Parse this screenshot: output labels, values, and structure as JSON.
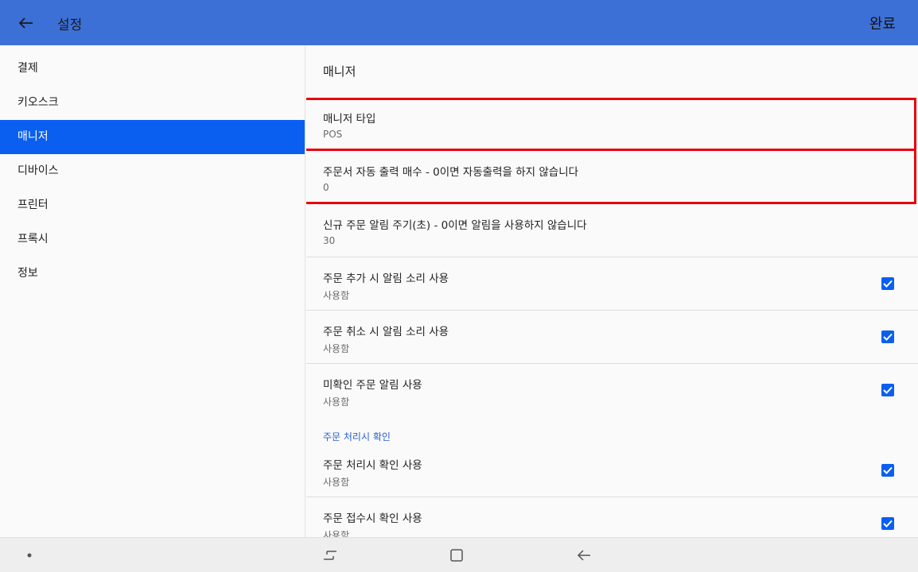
{
  "appbar": {
    "title": "설정",
    "done_label": "완료",
    "color": "#3d70d6"
  },
  "sidebar": {
    "items": [
      {
        "label": "결제",
        "active": false
      },
      {
        "label": "키오스크",
        "active": false
      },
      {
        "label": "매니저",
        "active": true
      },
      {
        "label": "디바이스",
        "active": false
      },
      {
        "label": "프린터",
        "active": false
      },
      {
        "label": "프록시",
        "active": false
      },
      {
        "label": "정보",
        "active": false
      }
    ],
    "active_color": "#0a5ff0"
  },
  "main": {
    "header": "매니저",
    "settings": [
      {
        "title": "매니저 타입",
        "value": "POS",
        "highlighted": true
      },
      {
        "title": "주문서 자동 출력 매수 - 0이면 자동출력을 하지 않습니다",
        "value": "0",
        "highlighted": true
      },
      {
        "title": "신규 주문 알림 주기(초) - 0이면 알림을 사용하지 않습니다",
        "value": "30"
      },
      {
        "title": "주문 추가 시 알림 소리 사용",
        "value": "사용함",
        "checked": true
      },
      {
        "title": "주문 취소 시 알림 소리 사용",
        "value": "사용함",
        "checked": true
      },
      {
        "title": "미확인 주문 알림 사용",
        "value": "사용함",
        "checked": true
      }
    ],
    "category_label": "주문 처리시 확인",
    "category_settings": [
      {
        "title": "주문 처리시 확인 사용",
        "value": "사용함",
        "checked": true
      },
      {
        "title": "주문 접수시 확인 사용",
        "value": "사용함",
        "checked": true
      }
    ],
    "highlight_color": "#e8000b",
    "category_color": "#2a5fcf"
  },
  "navbar": {
    "icons": [
      "dot-icon",
      "recent-apps-icon",
      "home-icon",
      "back-icon"
    ]
  }
}
